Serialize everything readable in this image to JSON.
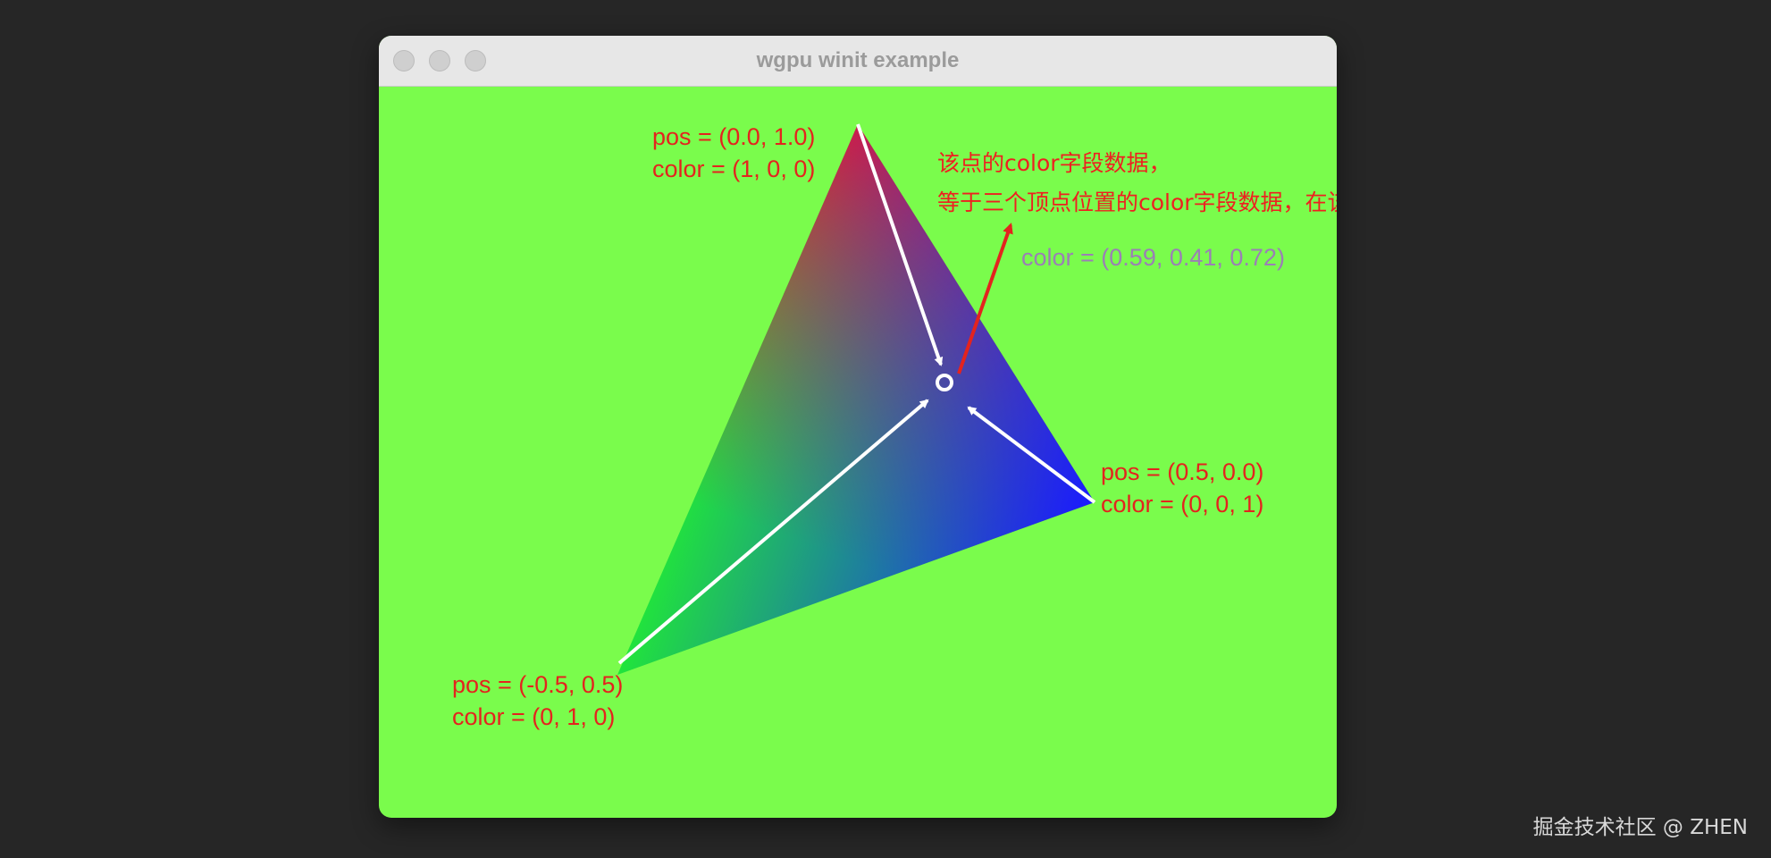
{
  "window": {
    "title": "wgpu winit example",
    "background_color": "#7afc4c"
  },
  "vertices": {
    "top": {
      "pos": "pos = (0.0, 1.0)",
      "color": "color = (1, 0, 0)",
      "rgb": "#ff0000"
    },
    "right": {
      "pos": "pos = (0.5,  0.0)",
      "color": "color = (0, 0, 1)",
      "rgb": "#0000ff"
    },
    "left": {
      "pos": "pos = (-0.5, 0.5)",
      "color": "color = (0, 1, 0)",
      "rgb": "#00ff00"
    }
  },
  "sample_point": {
    "color": "color = (0.59, 0.41, 0.72)"
  },
  "annotation": {
    "line1": "该点的color字段数据，",
    "line2": "等于三个顶点位置的color字段数据，在该处通过算法进行的叠加结果"
  },
  "watermark": "掘金技术社区 @ ZHEN"
}
